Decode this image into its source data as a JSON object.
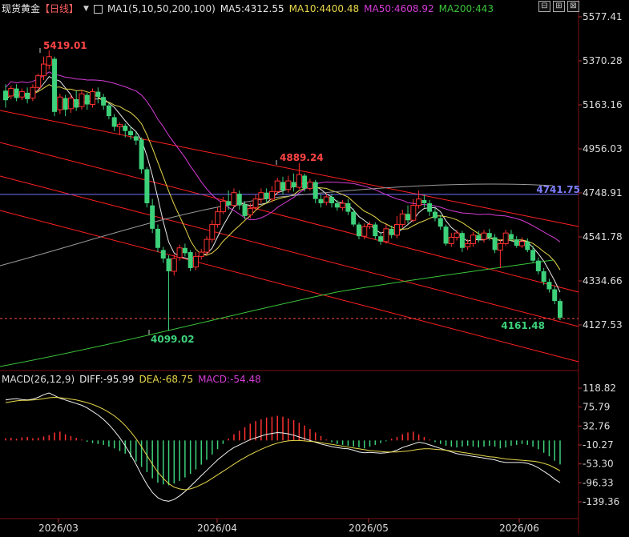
{
  "header": {
    "symbol": "现货黄金",
    "period": "【日线】",
    "ma_label": "MA1(5,10,50,200,100)",
    "ma5": "MA5:4312.55",
    "ma10": "MA10:4400.48",
    "ma50": "MA50:4608.92",
    "ma200": "MA200:443",
    "window_buttons": [
      "⊟",
      "⊞",
      "⊠"
    ]
  },
  "macd_header": {
    "label": "MACD(26,12,9)",
    "diff": "DIFF:-95.99",
    "dea": "DEA:-68.75",
    "macd": "MACD:-54.48"
  },
  "colors": {
    "up": "#ff3030",
    "down": "#3dd17a",
    "ma5": "#e8e8e8",
    "ma10": "#e8d84a",
    "ma50": "#d63cd6",
    "ma200": "#3bc63b",
    "ma100": "#9a9a9a",
    "hline": "#6f6fff",
    "channel": "#ff2020",
    "axis_text": "#dddddd"
  },
  "chart_data": [
    {
      "type": "candlestick",
      "title": "现货黄金【日线】",
      "price_ticks": [
        "5577.41",
        "5370.28",
        "5163.16",
        "4956.03",
        "4748.91",
        "4541.78",
        "4334.66",
        "4127.53"
      ],
      "ylim": [
        4050,
        5600
      ],
      "x_labels": [
        "2026/03",
        "2026/04",
        "2026/05",
        "2026/06"
      ],
      "annotations": [
        {
          "text": "5419.01",
          "value": 5419.01
        },
        {
          "text": "4889.24",
          "value": 4889.24
        },
        {
          "text": "4099.02",
          "value": 4099.02
        },
        {
          "text": "4161.48",
          "value": 4161.48
        },
        {
          "text": "4741.75",
          "value": 4741.75
        }
      ],
      "horizontal_line": 4741.75,
      "last_price": 4161.48,
      "candles": [
        [
          5230,
          5185,
          5260,
          5150
        ],
        [
          5205,
          5240,
          5255,
          5190
        ],
        [
          5240,
          5195,
          5260,
          5180
        ],
        [
          5200,
          5225,
          5240,
          5185
        ],
        [
          5220,
          5190,
          5245,
          5170
        ],
        [
          5195,
          5245,
          5260,
          5180
        ],
        [
          5245,
          5300,
          5310,
          5230
        ],
        [
          5300,
          5355,
          5390,
          5280
        ],
        [
          5350,
          5390,
          5419.01,
          5330
        ],
        [
          5380,
          5130,
          5390,
          5110
        ],
        [
          5140,
          5200,
          5215,
          5120
        ],
        [
          5195,
          5140,
          5210,
          5110
        ],
        [
          5145,
          5195,
          5210,
          5125
        ],
        [
          5190,
          5150,
          5230,
          5135
        ],
        [
          5155,
          5215,
          5235,
          5140
        ],
        [
          5210,
          5165,
          5220,
          5140
        ],
        [
          5165,
          5225,
          5240,
          5150
        ],
        [
          5225,
          5200,
          5245,
          5170
        ],
        [
          5200,
          5160,
          5215,
          5140
        ],
        [
          5160,
          5110,
          5175,
          5095
        ],
        [
          5105,
          5060,
          5120,
          5040
        ],
        [
          5060,
          5070,
          5080,
          5020
        ],
        [
          5065,
          5040,
          5075,
          5010
        ],
        [
          5040,
          5020,
          5060,
          5000
        ],
        [
          5015,
          4995,
          5035,
          4975
        ],
        [
          5000,
          4860,
          5010,
          4840
        ],
        [
          4860,
          4700,
          4870,
          4680
        ],
        [
          4690,
          4580,
          4720,
          4560
        ],
        [
          4580,
          4490,
          4600,
          4470
        ],
        [
          4480,
          4440,
          4495,
          4420
        ],
        [
          4440,
          4380,
          4455,
          4099.02
        ],
        [
          4380,
          4440,
          4460,
          4360
        ],
        [
          4445,
          4490,
          4505,
          4430
        ],
        [
          4490,
          4465,
          4510,
          4450
        ],
        [
          4470,
          4395,
          4480,
          4380
        ],
        [
          4400,
          4450,
          4470,
          4385
        ],
        [
          4450,
          4470,
          4485,
          4435
        ],
        [
          4470,
          4530,
          4545,
          4455
        ],
        [
          4530,
          4600,
          4620,
          4515
        ],
        [
          4600,
          4660,
          4680,
          4585
        ],
        [
          4660,
          4710,
          4730,
          4650
        ],
        [
          4710,
          4690,
          4760,
          4670
        ],
        [
          4690,
          4750,
          4770,
          4680
        ],
        [
          4745,
          4690,
          4760,
          4670
        ],
        [
          4695,
          4640,
          4710,
          4625
        ],
        [
          4645,
          4675,
          4700,
          4630
        ],
        [
          4680,
          4720,
          4740,
          4665
        ],
        [
          4720,
          4750,
          4770,
          4700
        ],
        [
          4750,
          4720,
          4770,
          4705
        ],
        [
          4720,
          4755,
          4780,
          4705
        ],
        [
          4755,
          4805,
          4820,
          4740
        ],
        [
          4800,
          4760,
          4825,
          4740
        ],
        [
          4765,
          4805,
          4830,
          4750
        ],
        [
          4800,
          4775,
          4840,
          4755
        ],
        [
          4775,
          4835,
          4889.24,
          4765
        ],
        [
          4830,
          4770,
          4840,
          4755
        ],
        [
          4770,
          4800,
          4815,
          4760
        ],
        [
          4800,
          4720,
          4810,
          4700
        ],
        [
          4720,
          4700,
          4740,
          4680
        ],
        [
          4705,
          4730,
          4745,
          4690
        ],
        [
          4730,
          4700,
          4745,
          4680
        ],
        [
          4700,
          4680,
          4715,
          4665
        ],
        [
          4680,
          4700,
          4715,
          4665
        ],
        [
          4700,
          4660,
          4720,
          4645
        ],
        [
          4660,
          4600,
          4675,
          4590
        ],
        [
          4600,
          4545,
          4610,
          4530
        ],
        [
          4545,
          4590,
          4605,
          4530
        ],
        [
          4590,
          4600,
          4615,
          4580
        ],
        [
          4600,
          4545,
          4610,
          4530
        ],
        [
          4545,
          4520,
          4560,
          4505
        ],
        [
          4520,
          4580,
          4600,
          4510
        ],
        [
          4580,
          4550,
          4595,
          4535
        ],
        [
          4550,
          4600,
          4640,
          4535
        ],
        [
          4600,
          4650,
          4670,
          4585
        ],
        [
          4650,
          4620,
          4690,
          4605
        ],
        [
          4620,
          4690,
          4720,
          4610
        ],
        [
          4690,
          4720,
          4760,
          4675
        ],
        [
          4715,
          4700,
          4740,
          4680
        ],
        [
          4700,
          4660,
          4715,
          4640
        ],
        [
          4660,
          4630,
          4680,
          4615
        ],
        [
          4630,
          4590,
          4645,
          4575
        ],
        [
          4590,
          4510,
          4600,
          4500
        ],
        [
          4510,
          4540,
          4560,
          4495
        ],
        [
          4540,
          4560,
          4575,
          4525
        ],
        [
          4560,
          4490,
          4570,
          4470
        ],
        [
          4495,
          4510,
          4530,
          4480
        ],
        [
          4510,
          4550,
          4565,
          4495
        ],
        [
          4550,
          4530,
          4570,
          4515
        ],
        [
          4530,
          4560,
          4575,
          4515
        ],
        [
          4560,
          4540,
          4580,
          4525
        ],
        [
          4540,
          4480,
          4555,
          4465
        ],
        [
          4480,
          4510,
          4530,
          4395
        ],
        [
          4510,
          4560,
          4575,
          4500
        ],
        [
          4555,
          4530,
          4575,
          4520
        ],
        [
          4530,
          4500,
          4545,
          4490
        ],
        [
          4500,
          4520,
          4540,
          4490
        ],
        [
          4520,
          4480,
          4535,
          4470
        ],
        [
          4480,
          4430,
          4500,
          4420
        ],
        [
          4430,
          4380,
          4445,
          4365
        ],
        [
          4380,
          4330,
          4395,
          4315
        ],
        [
          4330,
          4295,
          4345,
          4280
        ],
        [
          4295,
          4240,
          4310,
          4225
        ],
        [
          4240,
          4161.48,
          4250,
          4150
        ]
      ]
    },
    {
      "type": "bar",
      "title": "MACD(26,12,9)",
      "y_ticks": [
        "118.82",
        "75.79",
        "32.76",
        "-10.27",
        "-53.30",
        "-96.33",
        "-139.36"
      ],
      "ylim": [
        -155,
        140
      ],
      "hist": [
        5,
        6,
        4,
        7,
        8,
        5,
        6,
        9,
        12,
        18,
        20,
        14,
        10,
        6,
        2,
        -3,
        -6,
        -8,
        -10,
        -14,
        -18,
        -24,
        -30,
        -38,
        -48,
        -60,
        -72,
        -86,
        -96,
        -100,
        -102,
        -98,
        -92,
        -84,
        -76,
        -66,
        -55,
        -44,
        -32,
        -20,
        -8,
        4,
        14,
        22,
        30,
        38,
        44,
        48,
        52,
        54,
        56,
        54,
        50,
        46,
        40,
        34,
        26,
        18,
        10,
        2,
        -4,
        -8,
        -10,
        -12,
        -14,
        -16,
        -18,
        -14,
        -10,
        -6,
        -2,
        4,
        8,
        14,
        18,
        20,
        14,
        8,
        2,
        -4,
        -8,
        -12,
        -14,
        -16,
        -14,
        -12,
        -14,
        -16,
        -14,
        -12,
        -14,
        -18,
        -16,
        -12,
        -10,
        -8,
        -10,
        -14,
        -20,
        -28,
        -36,
        -46,
        -54.48
      ],
      "diff": [
        92,
        94,
        95,
        93,
        92,
        94,
        98,
        104,
        108,
        102,
        96,
        92,
        88,
        84,
        80,
        74,
        66,
        58,
        48,
        36,
        22,
        6,
        -12,
        -32,
        -54,
        -78,
        -100,
        -118,
        -130,
        -136,
        -138,
        -134,
        -126,
        -116,
        -104,
        -92,
        -80,
        -68,
        -56,
        -44,
        -34,
        -24,
        -16,
        -10,
        -4,
        2,
        6,
        10,
        14,
        16,
        18,
        17,
        15,
        12,
        8,
        4,
        0,
        -4,
        -8,
        -11,
        -14,
        -16,
        -18,
        -19,
        -22,
        -26,
        -28,
        -27,
        -28,
        -29,
        -28,
        -26,
        -22,
        -16,
        -12,
        -8,
        -4,
        -6,
        -10,
        -14,
        -18,
        -22,
        -26,
        -30,
        -32,
        -34,
        -36,
        -38,
        -40,
        -42,
        -44,
        -48,
        -50,
        -50,
        -50,
        -50,
        -52,
        -56,
        -62,
        -70,
        -78,
        -88,
        -95.99
      ],
      "dea": [
        86,
        88,
        90,
        91,
        91,
        92,
        93,
        95,
        97,
        98,
        97,
        96,
        94,
        92,
        89,
        86,
        82,
        77,
        71,
        64,
        56,
        46,
        34,
        20,
        4,
        -14,
        -34,
        -54,
        -72,
        -86,
        -98,
        -106,
        -110,
        -112,
        -110,
        -106,
        -100,
        -94,
        -86,
        -78,
        -70,
        -62,
        -54,
        -46,
        -39,
        -32,
        -26,
        -20,
        -15,
        -10,
        -6,
        -3,
        -1,
        0,
        0,
        -1,
        -2,
        -3,
        -5,
        -7,
        -9,
        -11,
        -13,
        -15,
        -17,
        -19,
        -21,
        -23,
        -24,
        -25,
        -26,
        -26,
        -26,
        -25,
        -24,
        -22,
        -20,
        -19,
        -19,
        -20,
        -21,
        -22,
        -24,
        -25,
        -27,
        -29,
        -31,
        -33,
        -35,
        -37,
        -38,
        -40,
        -42,
        -43,
        -44,
        -45,
        -46,
        -47,
        -49,
        -52,
        -56,
        -62,
        -68.75
      ]
    }
  ]
}
